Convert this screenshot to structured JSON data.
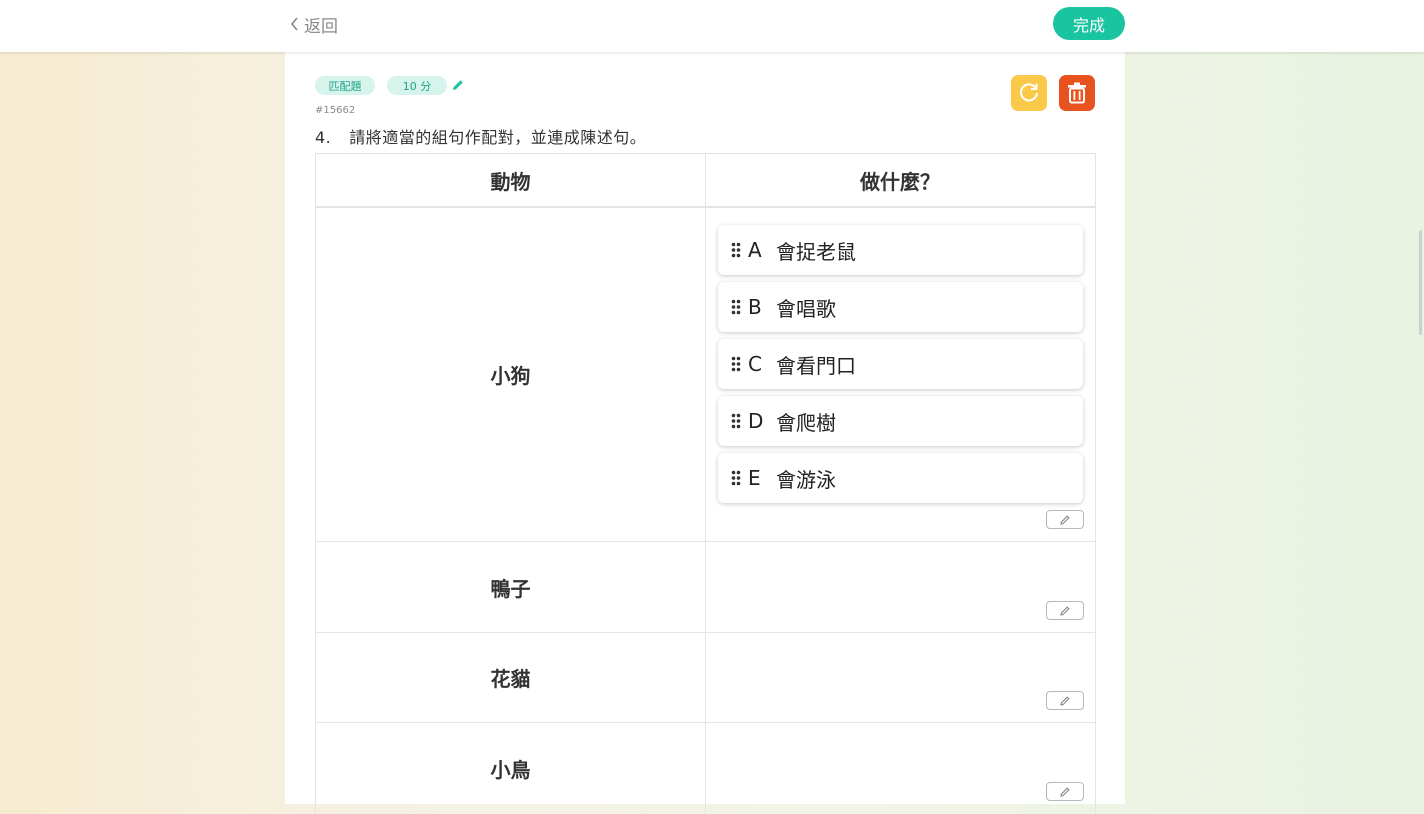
{
  "header": {
    "back_label": "返回",
    "done_label": "完成"
  },
  "question": {
    "type_tag": "匹配題",
    "score_tag": "10 分",
    "id": "#15662",
    "number": "4.",
    "text": "請將適當的組句作配對，並連成陳述句。"
  },
  "table": {
    "col_left": "動物",
    "col_right": "做什麼？",
    "rows": [
      {
        "animal": "小狗"
      },
      {
        "animal": "鴨子"
      },
      {
        "animal": "花貓"
      },
      {
        "animal": "小鳥"
      }
    ],
    "options": [
      {
        "letter": "A",
        "text": "會捉老鼠"
      },
      {
        "letter": "B",
        "text": "會唱歌"
      },
      {
        "letter": "C",
        "text": "會看門口"
      },
      {
        "letter": "D",
        "text": "會爬樹"
      },
      {
        "letter": "E",
        "text": "會游泳"
      }
    ]
  },
  "colors": {
    "accent": "#19c4a0",
    "tag_bg": "#d6f3ec",
    "reset_button": "#fbc94a",
    "delete_button": "#e8521f"
  },
  "icons": [
    "chevron-left-icon",
    "pencil-icon",
    "refresh-icon",
    "trash-icon",
    "drag-handle-icon"
  ]
}
